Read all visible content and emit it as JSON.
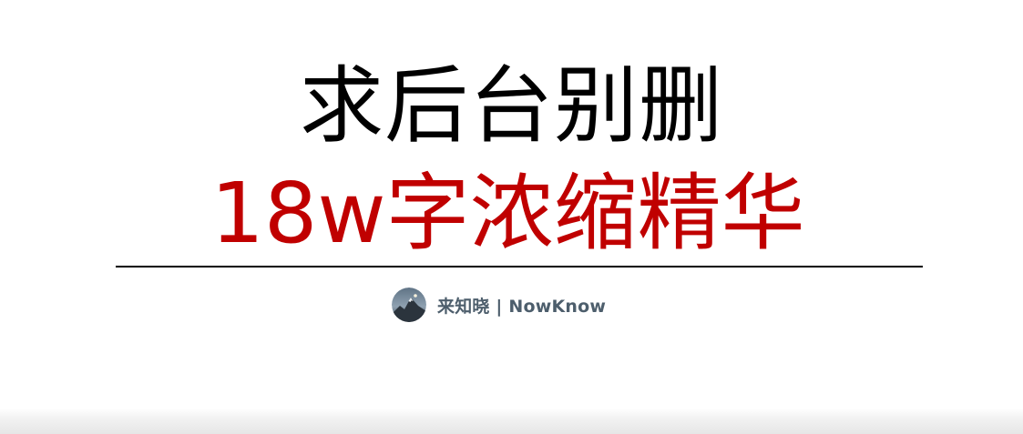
{
  "headline": "求后台别删",
  "subheadline": "18w字浓缩精华",
  "byline": {
    "author": "来知晓 | NowKnow"
  },
  "colors": {
    "headline": "#000000",
    "subheadline": "#c00000",
    "author": "#4d5e6c",
    "rule": "#000000"
  },
  "icons": {
    "avatar": "mountain-avatar-icon"
  }
}
